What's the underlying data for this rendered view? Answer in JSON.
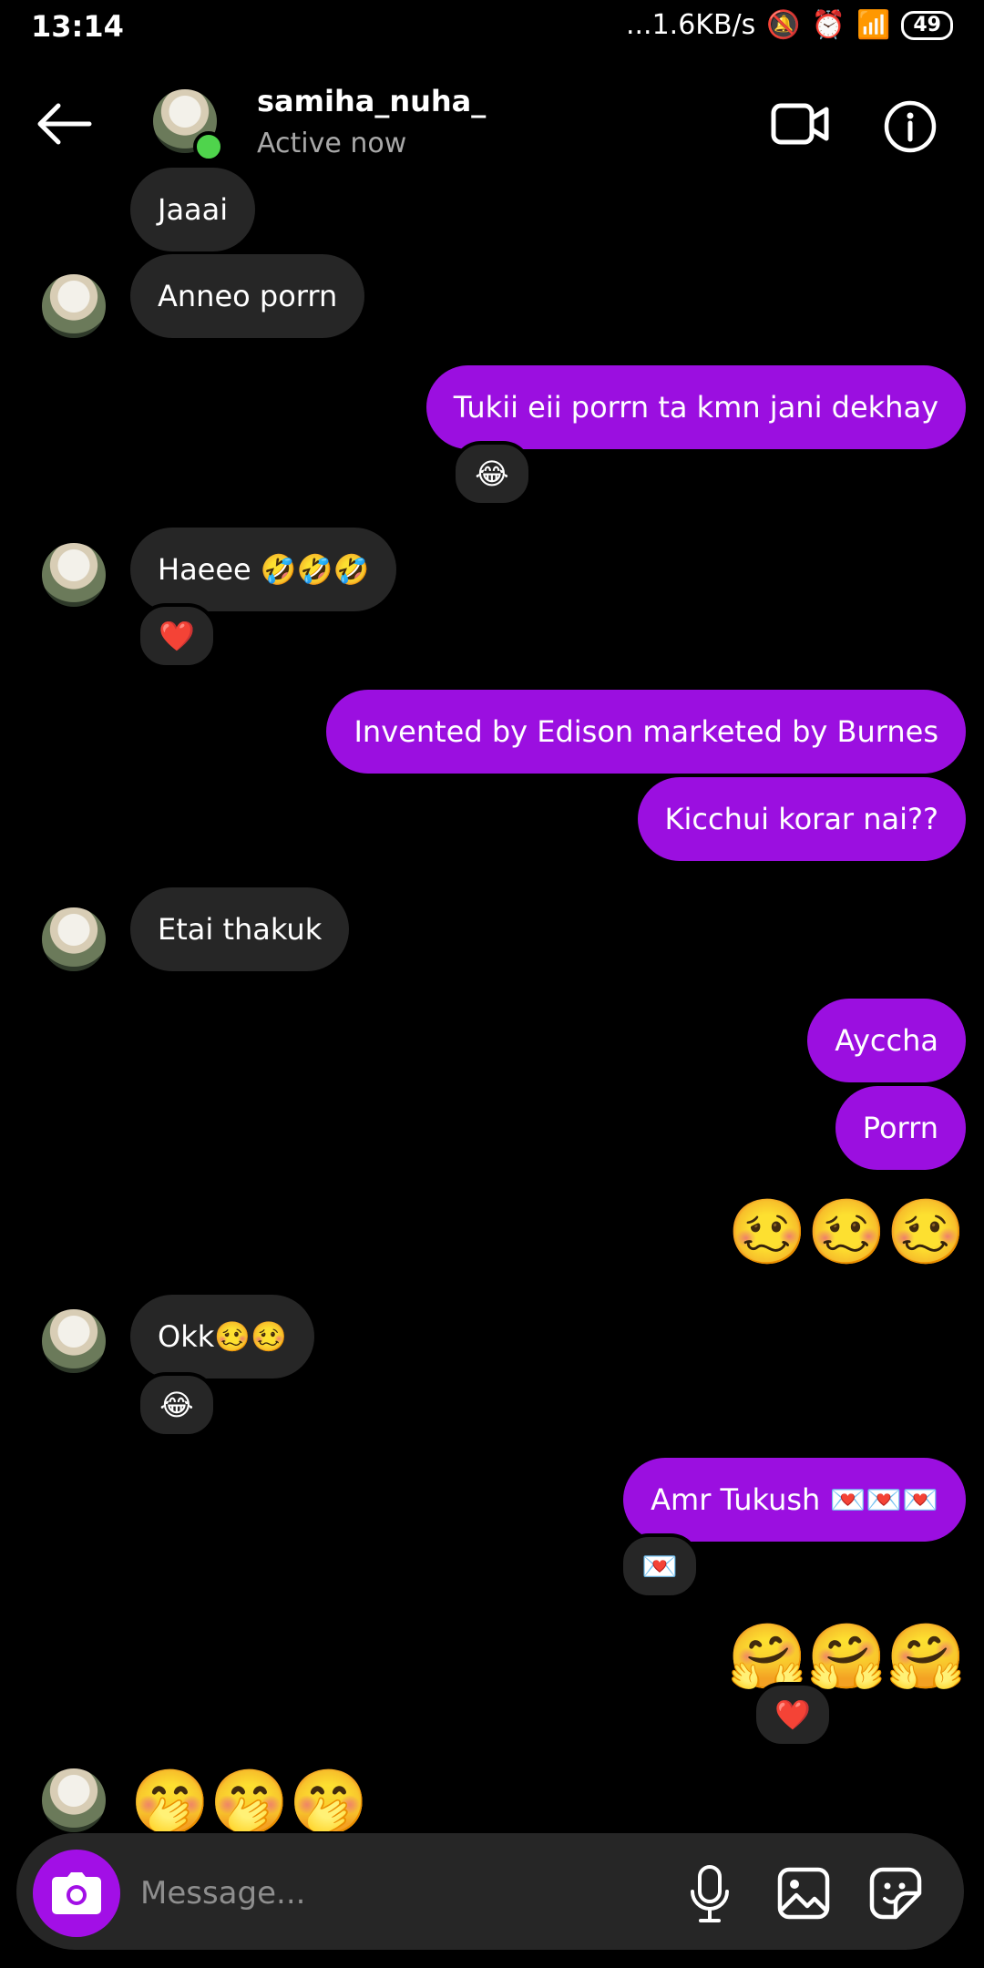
{
  "status_bar": {
    "time": "13:14",
    "network": "...1.6KB/s",
    "battery": "49"
  },
  "header": {
    "username": "samiha_nuha_",
    "status": "Active now",
    "icons": [
      "back-arrow-icon",
      "video-call-icon",
      "info-icon"
    ]
  },
  "messages": [
    {
      "side": "in",
      "text": "Jaaai"
    },
    {
      "side": "in",
      "text": "Anneo porrn"
    },
    {
      "side": "out",
      "text": "Tukii eii porrn ta kmn jani dekhay",
      "reaction": "😂"
    },
    {
      "side": "in",
      "text": "Haeee 🤣🤣🤣",
      "reaction": "❤️"
    },
    {
      "side": "out",
      "text": "Invented by Edison marketed by Burnes"
    },
    {
      "side": "out",
      "text": "Kicchui korar nai??"
    },
    {
      "side": "in",
      "text": "Etai thakuk"
    },
    {
      "side": "out",
      "text": "Ayccha"
    },
    {
      "side": "out",
      "text": "Porrn"
    },
    {
      "side": "out",
      "text": "🥴🥴🥴"
    },
    {
      "side": "in",
      "text": "Okk🥴🥴",
      "reaction": "😂"
    },
    {
      "side": "out",
      "text": "Amr Tukush 💌💌💌",
      "reaction": "💌"
    },
    {
      "side": "out",
      "text": "🤗🤗🤗",
      "reaction": "❤️"
    },
    {
      "side": "in",
      "text": "🤭🤭🤭"
    }
  ],
  "composer": {
    "placeholder": "Message...",
    "icons": [
      "camera-icon",
      "microphone-icon",
      "gallery-icon",
      "sticker-icon"
    ]
  },
  "colors": {
    "background": "#000000",
    "incoming_bubble": "#262626",
    "outgoing_bubble": "#9b0fe0",
    "online_dot": "#4fd44c"
  }
}
